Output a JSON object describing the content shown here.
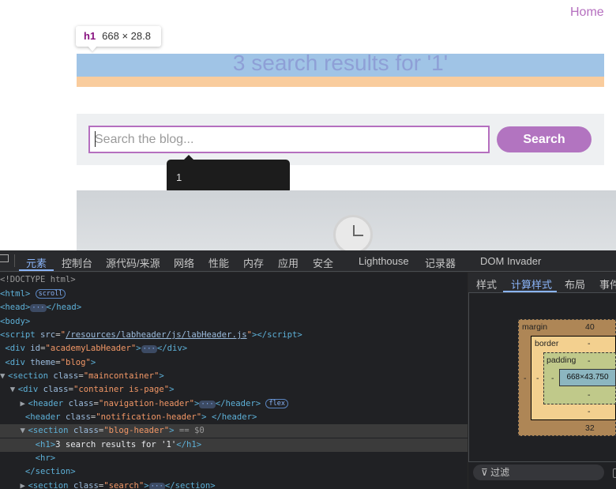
{
  "page": {
    "home_link": "Home",
    "inspect_tooltip": {
      "tag": "h1",
      "size": "668 × 28.8"
    },
    "heading": "3 search results for '1'",
    "search": {
      "placeholder": "Search the blog...",
      "button": "Search"
    },
    "autocomplete_value": "1"
  },
  "devtools": {
    "tabs": [
      "元素",
      "控制台",
      "源代码/来源",
      "网络",
      "性能",
      "内存",
      "应用",
      "安全",
      "Lighthouse",
      "记录器",
      "DOM Invader"
    ],
    "active_tab": "元素",
    "side_tabs": [
      "样式",
      "计算样式",
      "布局",
      "事件"
    ],
    "active_side_tab": "计算样式",
    "box_model": {
      "margin_label": "margin",
      "margin_top": "40",
      "margin_bottom": "32",
      "margin_left": "-",
      "border_label": "border",
      "border_top": "-",
      "border_bottom": "-",
      "border_left": "-",
      "padding_label": "padding",
      "padding_top": "-",
      "padding_bottom": "-",
      "padding_left": "-",
      "content": "668×43.750"
    },
    "filter_label": "过滤",
    "dom_lines": [
      {
        "t": "DOCTYPE",
        "text": "<!DOCTYPE html>"
      },
      {
        "t": "html",
        "badge": "scroll"
      },
      {
        "t": "head"
      },
      {
        "t": "body"
      },
      {
        "t": "script",
        "src": "/resources/labheader/js/labHeader.js"
      },
      {
        "t": "div-id",
        "id": "academyLabHeader"
      },
      {
        "t": "div-theme",
        "theme": "blog"
      },
      {
        "t": "section",
        "class": "maincontainer"
      },
      {
        "t": "div-class",
        "class": "container is-page"
      },
      {
        "t": "header-nav",
        "class": "navigation-header",
        "badge": "flex"
      },
      {
        "t": "header-notif",
        "class": "notification-header"
      },
      {
        "t": "section-blog",
        "class": "blog-header",
        "marker": "== $0"
      },
      {
        "t": "h1",
        "text": "3 search results for '1'"
      },
      {
        "t": "hr"
      },
      {
        "t": "section-close"
      },
      {
        "t": "section-search",
        "class": "search"
      }
    ]
  }
}
